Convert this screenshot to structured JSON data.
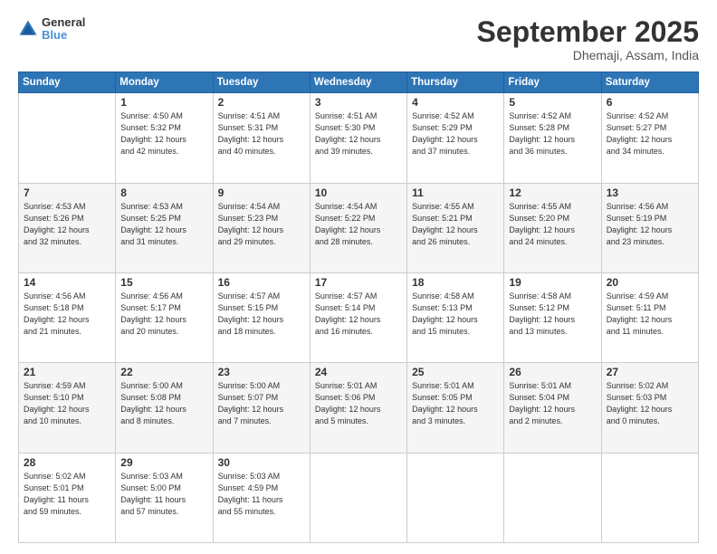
{
  "header": {
    "logo": {
      "line1": "General",
      "line2": "Blue"
    },
    "title": "September 2025",
    "subtitle": "Dhemaji, Assam, India"
  },
  "weekdays": [
    "Sunday",
    "Monday",
    "Tuesday",
    "Wednesday",
    "Thursday",
    "Friday",
    "Saturday"
  ],
  "weeks": [
    [
      {
        "day": "",
        "info": ""
      },
      {
        "day": "1",
        "info": "Sunrise: 4:50 AM\nSunset: 5:32 PM\nDaylight: 12 hours\nand 42 minutes."
      },
      {
        "day": "2",
        "info": "Sunrise: 4:51 AM\nSunset: 5:31 PM\nDaylight: 12 hours\nand 40 minutes."
      },
      {
        "day": "3",
        "info": "Sunrise: 4:51 AM\nSunset: 5:30 PM\nDaylight: 12 hours\nand 39 minutes."
      },
      {
        "day": "4",
        "info": "Sunrise: 4:52 AM\nSunset: 5:29 PM\nDaylight: 12 hours\nand 37 minutes."
      },
      {
        "day": "5",
        "info": "Sunrise: 4:52 AM\nSunset: 5:28 PM\nDaylight: 12 hours\nand 36 minutes."
      },
      {
        "day": "6",
        "info": "Sunrise: 4:52 AM\nSunset: 5:27 PM\nDaylight: 12 hours\nand 34 minutes."
      }
    ],
    [
      {
        "day": "7",
        "info": "Sunrise: 4:53 AM\nSunset: 5:26 PM\nDaylight: 12 hours\nand 32 minutes."
      },
      {
        "day": "8",
        "info": "Sunrise: 4:53 AM\nSunset: 5:25 PM\nDaylight: 12 hours\nand 31 minutes."
      },
      {
        "day": "9",
        "info": "Sunrise: 4:54 AM\nSunset: 5:23 PM\nDaylight: 12 hours\nand 29 minutes."
      },
      {
        "day": "10",
        "info": "Sunrise: 4:54 AM\nSunset: 5:22 PM\nDaylight: 12 hours\nand 28 minutes."
      },
      {
        "day": "11",
        "info": "Sunrise: 4:55 AM\nSunset: 5:21 PM\nDaylight: 12 hours\nand 26 minutes."
      },
      {
        "day": "12",
        "info": "Sunrise: 4:55 AM\nSunset: 5:20 PM\nDaylight: 12 hours\nand 24 minutes."
      },
      {
        "day": "13",
        "info": "Sunrise: 4:56 AM\nSunset: 5:19 PM\nDaylight: 12 hours\nand 23 minutes."
      }
    ],
    [
      {
        "day": "14",
        "info": "Sunrise: 4:56 AM\nSunset: 5:18 PM\nDaylight: 12 hours\nand 21 minutes."
      },
      {
        "day": "15",
        "info": "Sunrise: 4:56 AM\nSunset: 5:17 PM\nDaylight: 12 hours\nand 20 minutes."
      },
      {
        "day": "16",
        "info": "Sunrise: 4:57 AM\nSunset: 5:15 PM\nDaylight: 12 hours\nand 18 minutes."
      },
      {
        "day": "17",
        "info": "Sunrise: 4:57 AM\nSunset: 5:14 PM\nDaylight: 12 hours\nand 16 minutes."
      },
      {
        "day": "18",
        "info": "Sunrise: 4:58 AM\nSunset: 5:13 PM\nDaylight: 12 hours\nand 15 minutes."
      },
      {
        "day": "19",
        "info": "Sunrise: 4:58 AM\nSunset: 5:12 PM\nDaylight: 12 hours\nand 13 minutes."
      },
      {
        "day": "20",
        "info": "Sunrise: 4:59 AM\nSunset: 5:11 PM\nDaylight: 12 hours\nand 11 minutes."
      }
    ],
    [
      {
        "day": "21",
        "info": "Sunrise: 4:59 AM\nSunset: 5:10 PM\nDaylight: 12 hours\nand 10 minutes."
      },
      {
        "day": "22",
        "info": "Sunrise: 5:00 AM\nSunset: 5:08 PM\nDaylight: 12 hours\nand 8 minutes."
      },
      {
        "day": "23",
        "info": "Sunrise: 5:00 AM\nSunset: 5:07 PM\nDaylight: 12 hours\nand 7 minutes."
      },
      {
        "day": "24",
        "info": "Sunrise: 5:01 AM\nSunset: 5:06 PM\nDaylight: 12 hours\nand 5 minutes."
      },
      {
        "day": "25",
        "info": "Sunrise: 5:01 AM\nSunset: 5:05 PM\nDaylight: 12 hours\nand 3 minutes."
      },
      {
        "day": "26",
        "info": "Sunrise: 5:01 AM\nSunset: 5:04 PM\nDaylight: 12 hours\nand 2 minutes."
      },
      {
        "day": "27",
        "info": "Sunrise: 5:02 AM\nSunset: 5:03 PM\nDaylight: 12 hours\nand 0 minutes."
      }
    ],
    [
      {
        "day": "28",
        "info": "Sunrise: 5:02 AM\nSunset: 5:01 PM\nDaylight: 11 hours\nand 59 minutes."
      },
      {
        "day": "29",
        "info": "Sunrise: 5:03 AM\nSunset: 5:00 PM\nDaylight: 11 hours\nand 57 minutes."
      },
      {
        "day": "30",
        "info": "Sunrise: 5:03 AM\nSunset: 4:59 PM\nDaylight: 11 hours\nand 55 minutes."
      },
      {
        "day": "",
        "info": ""
      },
      {
        "day": "",
        "info": ""
      },
      {
        "day": "",
        "info": ""
      },
      {
        "day": "",
        "info": ""
      }
    ]
  ]
}
